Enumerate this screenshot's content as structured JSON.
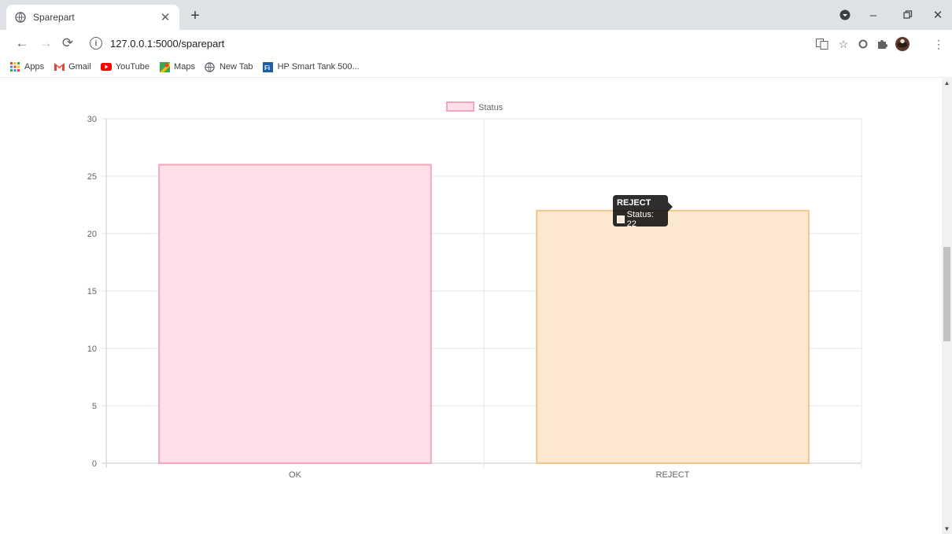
{
  "browser": {
    "tab_title": "Sparepart",
    "url": "127.0.0.1:5000/sparepart",
    "bookmarks": [
      {
        "label": "Apps",
        "icon": "apps-grid-icon"
      },
      {
        "label": "Gmail",
        "icon": "gmail-icon"
      },
      {
        "label": "YouTube",
        "icon": "youtube-icon"
      },
      {
        "label": "Maps",
        "icon": "maps-icon"
      },
      {
        "label": "New Tab",
        "icon": "globe-icon"
      },
      {
        "label": "HP Smart Tank 500...",
        "icon": "hp-icon"
      }
    ]
  },
  "chart_data": {
    "type": "bar",
    "categories": [
      "OK",
      "REJECT"
    ],
    "series": [
      {
        "name": "Status",
        "values": [
          26,
          22
        ],
        "fill_colors": [
          "#fde0e8",
          "#fde8d1"
        ],
        "border_colors": [
          "#f4a6bd",
          "#f4c58a"
        ]
      }
    ],
    "ylim": [
      0,
      30
    ],
    "yticks": [
      0,
      5,
      10,
      15,
      20,
      25,
      30
    ],
    "grid": true,
    "legend": "top",
    "legend_label": "Status",
    "tooltip": {
      "title": "REJECT",
      "label": "Status: 22",
      "category": "REJECT"
    }
  }
}
